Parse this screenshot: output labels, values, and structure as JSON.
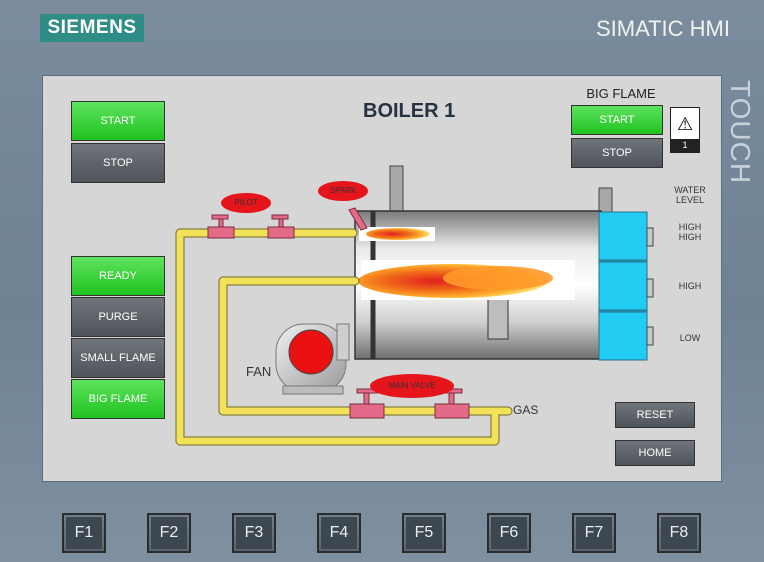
{
  "header": {
    "logo_text": "SIEMENS",
    "product": "SIMATIC HMI",
    "side_badge": "TOUCH"
  },
  "screen": {
    "title": "BOILER 1",
    "left_controls": {
      "start": "START",
      "stop": "STOP"
    },
    "status_buttons": [
      {
        "label": "READY",
        "state": "active"
      },
      {
        "label": "PURGE",
        "state": "inactive"
      },
      {
        "label": "SMALL FLAME",
        "state": "inactive"
      },
      {
        "label": "BIG FLAME",
        "state": "active"
      }
    ],
    "big_flame": {
      "label": "BIG FLAME",
      "start": "START",
      "stop": "STOP"
    },
    "alarm": {
      "count": "1"
    },
    "labels": {
      "pilot": "PILOT",
      "spark": "SPARK",
      "main_valve": "MAIN VALVE",
      "fan": "FAN",
      "gas": "GAS"
    },
    "water_level": {
      "title_line1": "WATER",
      "title_line2": "LEVEL",
      "high_high_line1": "HIGH",
      "high_high_line2": "HIGH",
      "high": "HIGH",
      "low": "LOW"
    },
    "actions": {
      "reset": "RESET",
      "home": "HOME"
    }
  },
  "function_keys": [
    "F1",
    "F2",
    "F3",
    "F4",
    "F5",
    "F6",
    "F7",
    "F8"
  ],
  "colors": {
    "active_green": "#22c822",
    "inactive_gray": "#5a6066",
    "pipe_yellow": "#f2e25b",
    "valve_red": "#e5151b",
    "water_blue": "#20c8ee",
    "bezel": "#6d8092",
    "screen_bg": "#d6d6d6"
  }
}
